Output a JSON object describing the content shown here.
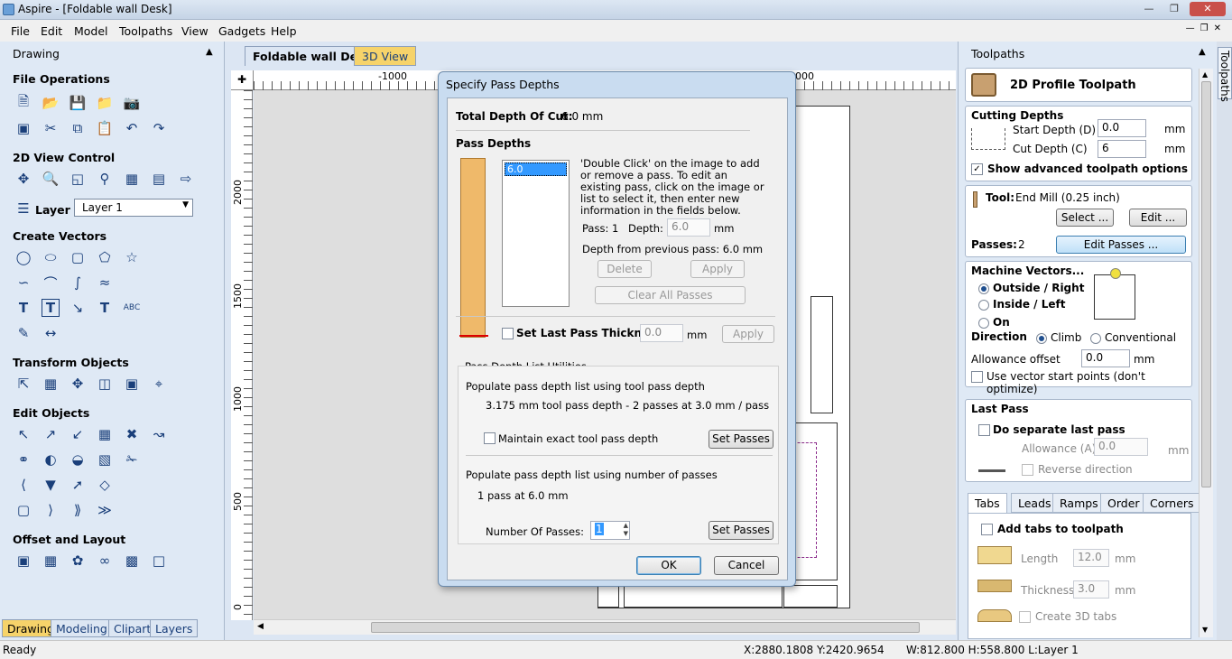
{
  "window": {
    "title": "Aspire - [Foldable wall Desk]"
  },
  "menu": [
    "File",
    "Edit",
    "Model",
    "Toolpaths",
    "View",
    "Gadgets",
    "Help"
  ],
  "left_panel": {
    "header": "Drawing",
    "file_operations": "File Operations",
    "view_control": "2D View Control",
    "layer_label": "Layer",
    "layer_value": "Layer 1",
    "create_vectors": "Create Vectors",
    "transform_objects": "Transform Objects",
    "edit_objects": "Edit Objects",
    "offset_layout": "Offset and Layout",
    "tabs": [
      "Drawing",
      "Modeling",
      "Clipart",
      "Layers"
    ]
  },
  "doc_tabs": [
    "Foldable wall Desk",
    "3D View"
  ],
  "ruler": {
    "top": [
      "-1000",
      "000"
    ],
    "left": [
      "2000",
      "1500",
      "1000",
      "500",
      "0"
    ]
  },
  "dialog": {
    "title": "Specify Pass Depths",
    "total_depth_label": "Total Depth Of Cut:",
    "total_depth_value": "6.0 mm",
    "pass_depths_label": "Pass Depths",
    "list_item": "6.0",
    "instructions": "'Double Click' on the image to add or remove a pass. To edit an existing pass, click on the image or list to select it, then enter new information in the fields below.",
    "pass_label": "Pass: 1",
    "depth_label": "Depth:",
    "depth_value": "6.0",
    "mm": "mm",
    "depth_prev": "Depth from previous pass:  6.0 mm",
    "delete": "Delete",
    "apply": "Apply",
    "clear_all": "Clear All Passes",
    "set_last_pass": "Set Last Pass Thickness",
    "last_pass_value": "0.0",
    "utilities_label": "Pass Depth List Utilities",
    "populate_tool": "Populate pass depth list using tool pass depth",
    "tool_info": "3.175 mm tool pass depth - 2 passes at 3.0 mm / pass",
    "maintain_exact": "Maintain exact tool pass depth",
    "set_passes": "Set Passes",
    "populate_number": "Populate pass depth list using number of passes",
    "pass_info": "1 pass at 6.0 mm",
    "number_label": "Number Of Passes:",
    "number_value": "1",
    "ok": "OK",
    "cancel": "Cancel"
  },
  "right_panel": {
    "header": "Toolpaths",
    "vertical_tab": "Toolpaths",
    "toolpath_title": "2D Profile Toolpath",
    "cutting_depths": "Cutting Depths",
    "start_depth_label": "Start Depth (D)",
    "start_depth_value": "0.0",
    "cut_depth_label": "Cut Depth (C)",
    "cut_depth_value": "6",
    "mm": "mm",
    "show_advanced": "Show advanced toolpath options",
    "tool_label": "Tool:",
    "tool_value": "End Mill (0.25 inch)",
    "select_btn": "Select ...",
    "edit_btn": "Edit ...",
    "passes_label": "Passes:",
    "passes_value": "2",
    "edit_passes_btn": "Edit Passes ...",
    "machine_vectors": "Machine Vectors...",
    "outside_right": "Outside / Right",
    "inside_left": "Inside / Left",
    "on": "On",
    "direction": "Direction",
    "climb": "Climb",
    "conventional": "Conventional",
    "allowance_offset": "Allowance offset",
    "allowance_value": "0.0",
    "use_vector_start": "Use vector start points (don't optimize)",
    "last_pass": "Last Pass",
    "do_separate": "Do separate last pass",
    "allowance_a": "Allowance (A)",
    "allowance_a_value": "0.0",
    "reverse_direction": "Reverse direction",
    "tabs": [
      "Tabs",
      "Leads",
      "Ramps",
      "Order",
      "Corners"
    ],
    "add_tabs": "Add tabs to toolpath",
    "length_label": "Length",
    "length_value": "12.0",
    "thickness_label": "Thickness",
    "thickness_value": "3.0",
    "create_3d_tabs": "Create 3D tabs"
  },
  "status": {
    "ready": "Ready",
    "coords": "X:2880.1808 Y:2420.9654",
    "size": "W:812.800  H:558.800  L:Layer 1"
  }
}
